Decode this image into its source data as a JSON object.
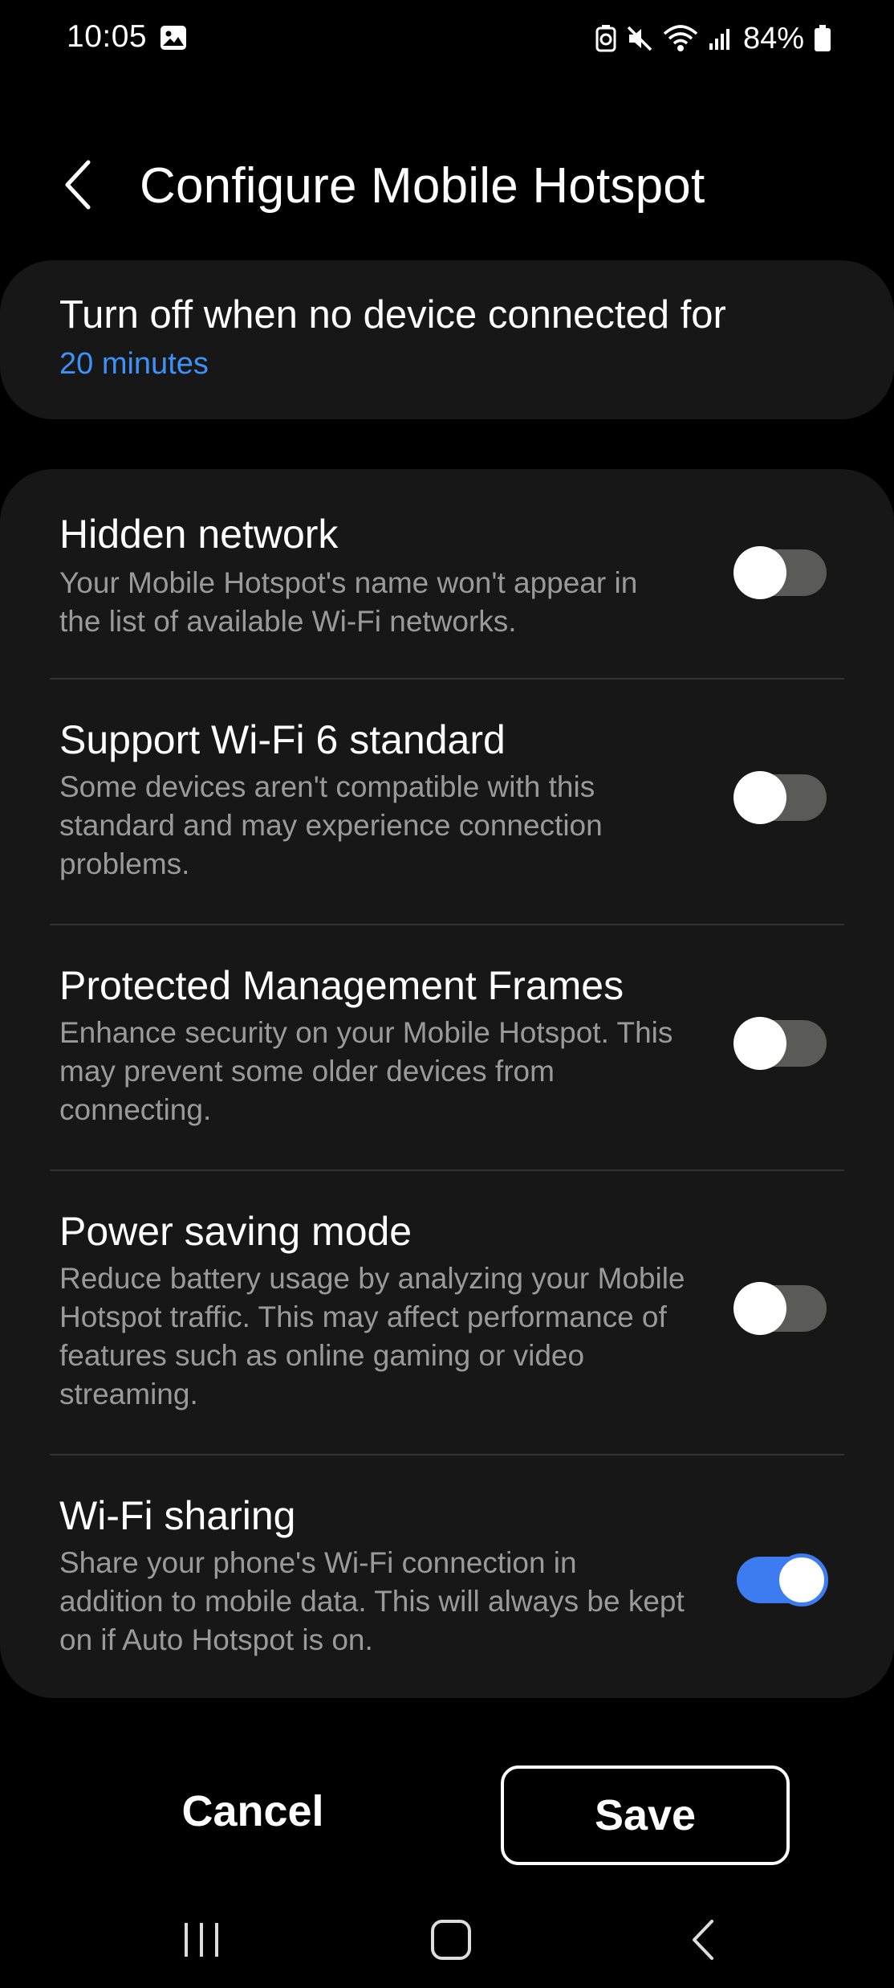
{
  "status_bar": {
    "time": "10:05",
    "battery_percent": "84%",
    "icons": [
      "gallery-icon",
      "data-saver-icon",
      "mute-icon",
      "wifi-icon",
      "signal-icon",
      "battery-icon"
    ]
  },
  "header": {
    "back_icon": "back-arrow-icon",
    "title": "Configure Mobile Hotspot"
  },
  "timeout": {
    "title": "Turn off when no device connected for",
    "value": "20 minutes",
    "accent_color": "#3e91f7"
  },
  "options": [
    {
      "title": "Hidden network",
      "description": "Your Mobile Hotspot's name won't appear in the list of available Wi-Fi networks.",
      "enabled": false
    },
    {
      "title": "Support Wi-Fi 6 standard",
      "description": "Some devices aren't compatible with this standard and may experience connection problems.",
      "enabled": false
    },
    {
      "title": "Protected Management Frames",
      "description": "Enhance security on your Mobile Hotspot. This may prevent some older devices from connecting.",
      "enabled": false
    },
    {
      "title": "Power saving mode",
      "description": "Reduce battery usage by analyzing your Mobile Hotspot traffic. This may affect performance of features such as online gaming or video streaming.",
      "enabled": false
    },
    {
      "title": "Wi-Fi sharing",
      "description": "Share your phone's Wi-Fi connection in addition to mobile data. This will always be kept on if Auto Hotspot is on.",
      "enabled": true
    }
  ],
  "actions": {
    "cancel_label": "Cancel",
    "save_label": "Save"
  },
  "nav": {
    "icons": [
      "recent-apps-icon",
      "home-icon",
      "back-icon"
    ]
  },
  "colors": {
    "toggle_on": "#3d7cf0",
    "toggle_off": "#5a5a57",
    "card_bg": "#171717"
  }
}
